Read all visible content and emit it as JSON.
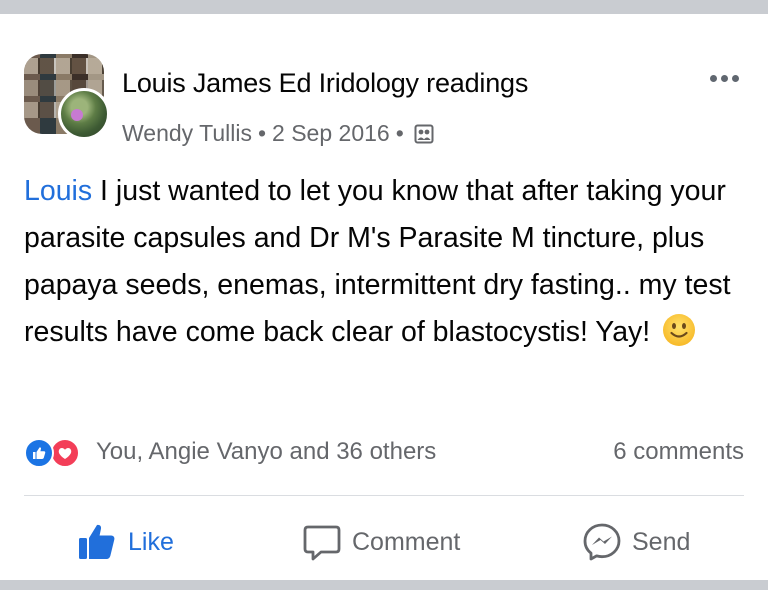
{
  "post": {
    "group_name": "Louis James Ed Iridology readings",
    "author": "Wendy Tullis",
    "separator": "•",
    "date": "2 Sep 2016",
    "privacy_icon": "group-members-icon",
    "more_icon": "more-options-icon"
  },
  "content": {
    "mention": "Louis",
    "text": " I just wanted to let you know that after taking your parasite capsules and Dr M's Parasite M tincture, plus papaya seeds, enemas, intermittent dry fasting.. my test results have come back clear of blastocystis!  Yay!",
    "emoji": "slightly-smiling-face"
  },
  "engagement": {
    "reactions": [
      "like",
      "love"
    ],
    "reaction_text": "You, Angie Vanyo and 36 others",
    "comments_text": "6 comments"
  },
  "actions": {
    "like_label": "Like",
    "comment_label": "Comment",
    "send_label": "Send"
  },
  "colors": {
    "accent": "#216fdb",
    "text": "#050505",
    "secondary_text": "#65676b",
    "like_blue": "#1b74e4",
    "love_red": "#f33e58",
    "background": "#c9ccd1"
  }
}
